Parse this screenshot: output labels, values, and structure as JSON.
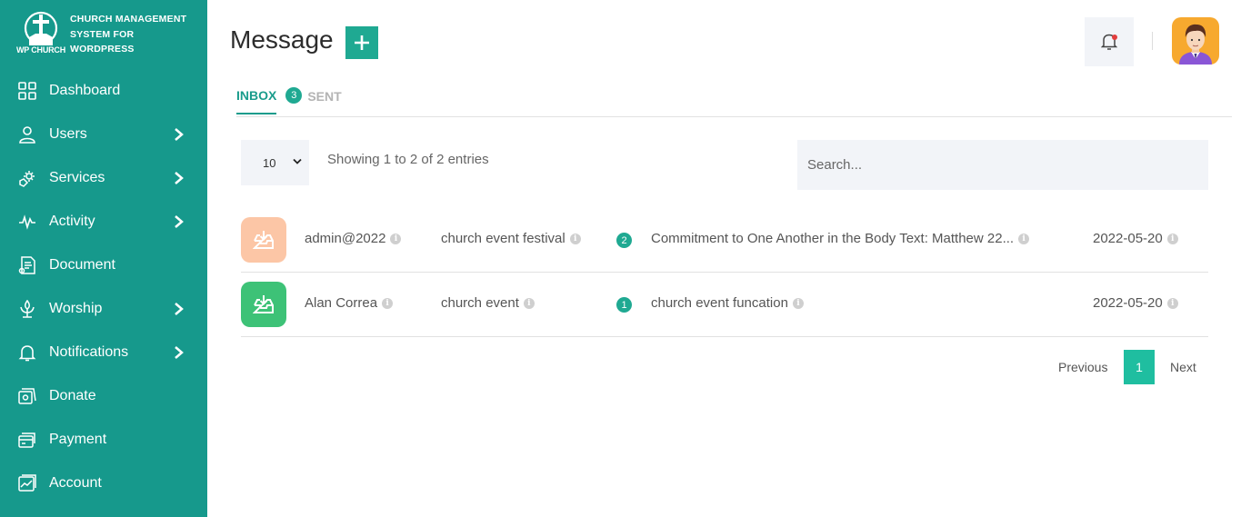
{
  "brand": {
    "logo_text": "WP CHURCH",
    "line1": "CHURCH MANAGEMENT",
    "line2": "SYSTEM FOR",
    "line3": "WORDPRESS"
  },
  "sidebar": {
    "items": [
      {
        "label": "Dashboard",
        "icon": "grid-icon",
        "has_submenu": false
      },
      {
        "label": "Users",
        "icon": "user-icon",
        "has_submenu": true
      },
      {
        "label": "Services",
        "icon": "services-icon",
        "has_submenu": true
      },
      {
        "label": "Activity",
        "icon": "pulse-icon",
        "has_submenu": true
      },
      {
        "label": "Document",
        "icon": "document-icon",
        "has_submenu": false
      },
      {
        "label": "Worship",
        "icon": "worship-icon",
        "has_submenu": true
      },
      {
        "label": "Notifications",
        "icon": "bell-icon",
        "has_submenu": true
      },
      {
        "label": "Donate",
        "icon": "donate-icon",
        "has_submenu": false
      },
      {
        "label": "Payment",
        "icon": "payment-icon",
        "has_submenu": false
      },
      {
        "label": "Account",
        "icon": "account-icon",
        "has_submenu": false
      }
    ]
  },
  "header": {
    "title": "Message",
    "add_label": "+"
  },
  "tabs": {
    "inbox": "INBOX",
    "badge": "3",
    "sent": "SENT"
  },
  "table": {
    "page_length": "10",
    "showing": "Showing 1 to 2 of 2 entries",
    "search_placeholder": "Search...",
    "rows": [
      {
        "sender": "admin@2022",
        "subject": "church event festival",
        "count": "2",
        "message": "Commitment to One Another in the Body Text: Matthew 22...",
        "date": "2022-05-20",
        "tile_color": "#fcc6a6"
      },
      {
        "sender": "Alan Correa",
        "subject": "church event",
        "count": "1",
        "message": "church event funcation",
        "date": "2022-05-20",
        "tile_color": "#3dc277"
      }
    ]
  },
  "pagination": {
    "previous": "Previous",
    "current": "1",
    "next": "Next"
  },
  "colors": {
    "sidebar": "#16998c",
    "accent": "#1fa992"
  }
}
